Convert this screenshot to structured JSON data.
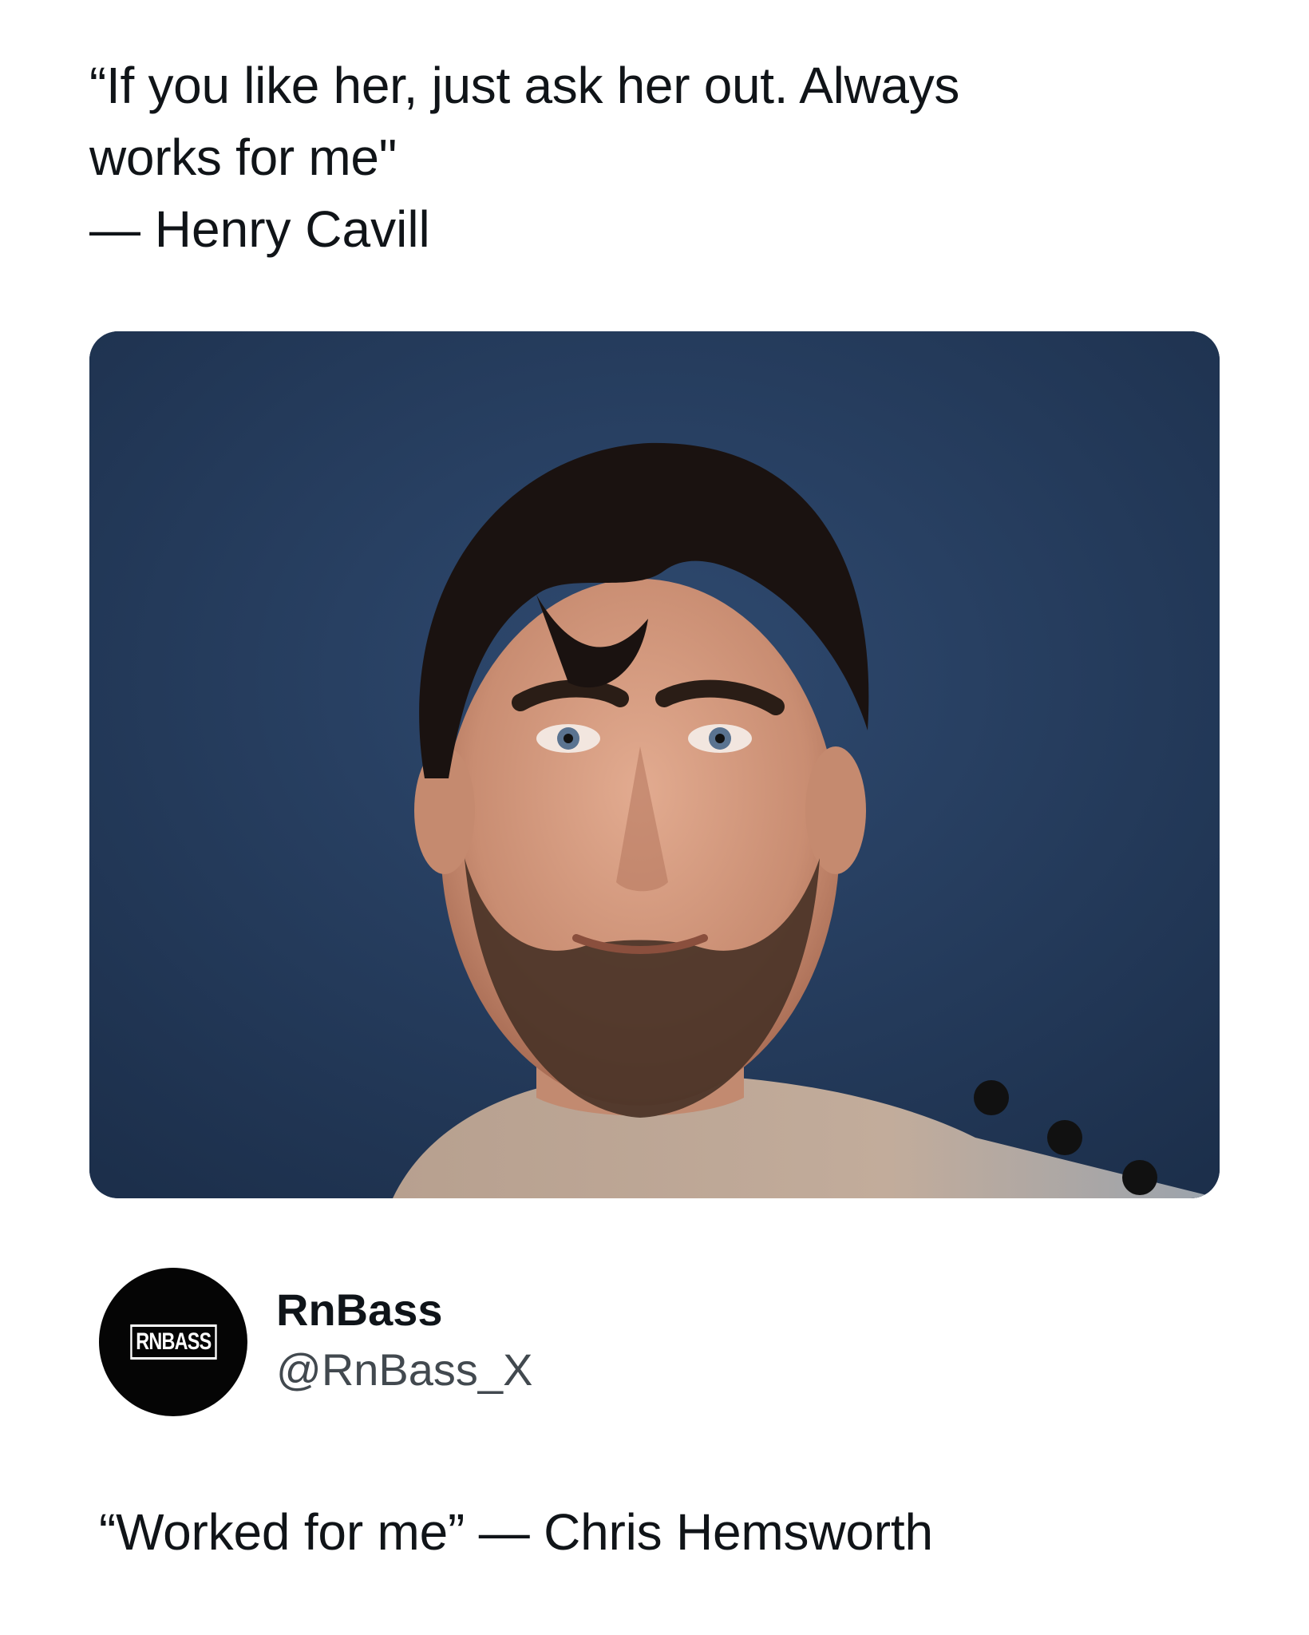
{
  "post": {
    "quote_line_1": "“If you like her, just ask her out. Always",
    "quote_line_2": "works for me\"",
    "attribution": "— Henry Cavill"
  },
  "photo": {
    "description_icon": "portrait-photo",
    "background_color": "#243a5a"
  },
  "profile": {
    "avatar_logo_text": "RNBASS",
    "name": "RnBass",
    "handle": "@RnBass_X"
  },
  "caption": {
    "text": "“Worked for me” — Chris Hemsworth"
  }
}
